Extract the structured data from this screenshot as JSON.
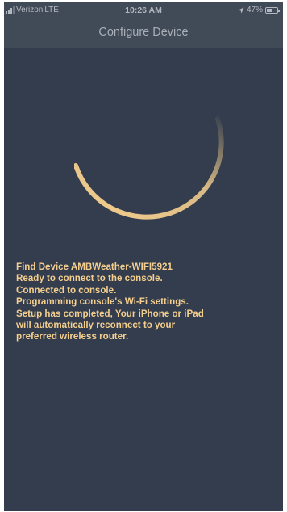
{
  "status_bar": {
    "carrier": "Verizon",
    "network": "LTE",
    "time": "10:26 AM",
    "battery_percent": "47%",
    "battery_level": 0.47,
    "icons": [
      "signal-bars-icon",
      "location-arrow-icon",
      "battery-icon"
    ]
  },
  "nav": {
    "title": "Configure Device"
  },
  "progress_log": [
    "Find Device AMBWeather-WIFI5921",
    "Ready to connect to the console.",
    "Connected to console.",
    "Programming console's Wi-Fi settings.",
    "Setup has completed, Your iPhone or iPad",
    "will automatically reconnect to your",
    "preferred wireless router."
  ],
  "colors": {
    "background": "#333d4d",
    "bar": "#414a57",
    "accent": "#f5cf8e",
    "status_text": "#b3b8c0"
  }
}
